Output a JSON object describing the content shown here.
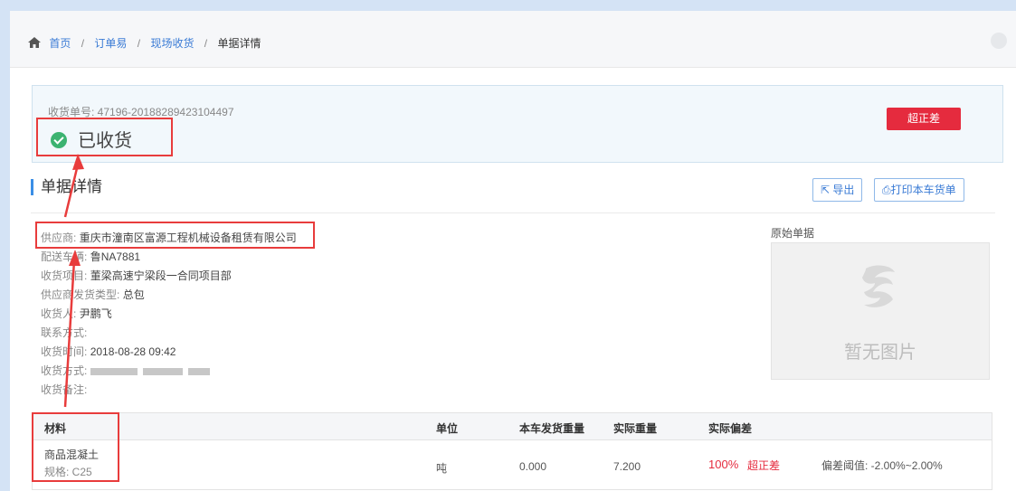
{
  "breadcrumb": {
    "items": [
      "首页",
      "订单易",
      "现场收货"
    ],
    "separator": "/",
    "current": "单据详情"
  },
  "status_panel": {
    "receipt_no": "收货单号: 47196-20188289423104497",
    "status": "已收货",
    "tag_button": "超正差"
  },
  "section": {
    "title": "单据详情",
    "export_label": "导出",
    "print_label": "打印本车货单"
  },
  "info": {
    "supplier": {
      "label": "供应商:",
      "value": "重庆市潼南区富源工程机械设备租赁有限公司"
    },
    "vehicle": {
      "label": "配送车辆:",
      "value": "鲁NA7881"
    },
    "project": {
      "label": "收货项目:",
      "value": "董梁高速宁梁段一合同项目部"
    },
    "ship_type": {
      "label": "供应商发货类型:",
      "value": "总包"
    },
    "receiver": {
      "label": "收货人:",
      "value": "尹鹏飞"
    },
    "contact": {
      "label": "联系方式:",
      "value": ""
    },
    "time": {
      "label": "收货时间:",
      "value": "2018-08-28 09:42"
    },
    "method": {
      "label": "收货方式:",
      "value": ""
    },
    "remark": {
      "label": "收货备注:",
      "value": ""
    }
  },
  "original_doc": {
    "label": "原始单据",
    "placeholder": "暂无图片"
  },
  "table": {
    "headers": [
      "材料",
      "单位",
      "本车发货重量",
      "实际重量",
      "实际偏差"
    ],
    "rows": [
      {
        "material": "商品混凝土",
        "spec": "规格: C25",
        "unit": "吨",
        "ship_weight": "0.000",
        "actual_weight": "7.200",
        "deviation": "100%",
        "deviation_tag": "超正差",
        "threshold": "偏差阈值: -2.00%~2.00%"
      }
    ]
  },
  "colors": {
    "accent": "#3a7bd5",
    "danger": "#e52b3e",
    "success": "#3cb371",
    "annotation": "#e83c3c"
  }
}
